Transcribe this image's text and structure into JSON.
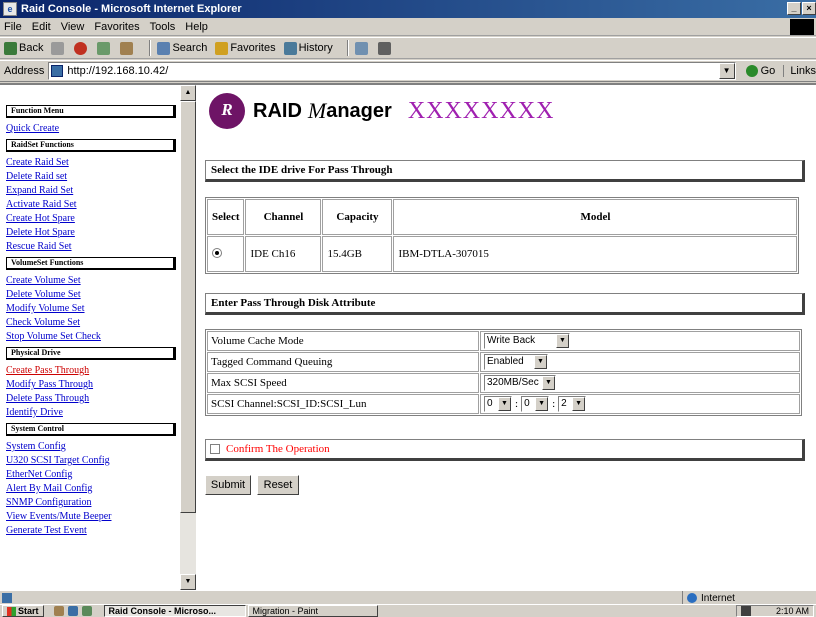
{
  "window": {
    "title": "Raid Console - Microsoft Internet Explorer",
    "controls": [
      "_",
      "×"
    ]
  },
  "menubar": [
    "File",
    "Edit",
    "View",
    "Favorites",
    "Tools",
    "Help"
  ],
  "toolbar": {
    "back": "Back",
    "search": "Search",
    "favorites": "Favorites",
    "history": "History"
  },
  "addressbar": {
    "label": "Address",
    "url": "http://192.168.10.42/",
    "go": "Go",
    "links": "Links"
  },
  "left_menu": {
    "sections": [
      {
        "header": "Function Menu",
        "items": [
          {
            "label": "Quick Create",
            "active": false
          }
        ]
      },
      {
        "header": "RaidSet Functions",
        "items": [
          {
            "label": "Create Raid Set",
            "active": false
          },
          {
            "label": "Delete Raid set",
            "active": false
          },
          {
            "label": "Expand Raid Set",
            "active": false
          },
          {
            "label": "Activate Raid Set",
            "active": false
          },
          {
            "label": "Create Hot Spare",
            "active": false
          },
          {
            "label": "Delete Hot Spare",
            "active": false
          },
          {
            "label": "Rescue Raid Set",
            "active": false
          }
        ]
      },
      {
        "header": "VolumeSet Functions",
        "items": [
          {
            "label": "Create Volume Set",
            "active": false
          },
          {
            "label": "Delete Volume Set",
            "active": false
          },
          {
            "label": "Modify Volume Set",
            "active": false
          },
          {
            "label": "Check Volume Set",
            "active": false
          },
          {
            "label": "Stop Volume Set Check",
            "active": false
          }
        ]
      },
      {
        "header": "Physical Drive",
        "items": [
          {
            "label": "Create Pass Through",
            "active": true
          },
          {
            "label": "Modify Pass Through",
            "active": false
          },
          {
            "label": "Delete Pass Through",
            "active": false
          },
          {
            "label": "Identify Drive",
            "active": false
          }
        ]
      },
      {
        "header": "System Control",
        "items": [
          {
            "label": "System Config",
            "active": false
          },
          {
            "label": "U320 SCSI Target Config",
            "active": false
          },
          {
            "label": "EtherNet Config",
            "active": false
          },
          {
            "label": "Alert By Mail Config",
            "active": false
          },
          {
            "label": "SNMP Configuration",
            "active": false
          },
          {
            "label": "View Events/Mute Beeper",
            "active": false
          },
          {
            "label": "Generate Test Event",
            "active": false
          }
        ]
      }
    ]
  },
  "logo": {
    "badge": "R",
    "brand_raid": "RAID",
    "brand_m": "M",
    "brand_anager": "anager",
    "model": "XXXXXXXX"
  },
  "drive_section": {
    "title": "Select the IDE drive For Pass Through",
    "headers": [
      "Select",
      "Channel",
      "Capacity",
      "Model"
    ],
    "rows": [
      {
        "selected": true,
        "channel": "IDE Ch16",
        "capacity": "15.4GB",
        "model": "IBM-DTLA-307015"
      }
    ]
  },
  "attr_section": {
    "title": "Enter Pass Through Disk Attribute",
    "volume_cache_mode": {
      "label": "Volume Cache Mode",
      "value": "Write Back"
    },
    "tagged_command_queuing": {
      "label": "Tagged Command Queuing",
      "value": "Enabled"
    },
    "max_scsi_speed": {
      "label": "Max SCSI Speed",
      "value": "320MB/Sec"
    },
    "scsi_address": {
      "label": "SCSI Channel:SCSI_ID:SCSI_Lun",
      "channel": "0",
      "id": "0",
      "lun": "2",
      "sep": ":"
    }
  },
  "confirm": {
    "label": "Confirm The Operation",
    "checked": false
  },
  "buttons": {
    "submit": "Submit",
    "reset": "Reset"
  },
  "statusbar": {
    "zone": "Internet"
  },
  "taskbar": {
    "start": "Start",
    "tasks": [
      "Raid Console - Microso...",
      "Migration - Paint"
    ],
    "clock": "2:10 AM"
  }
}
